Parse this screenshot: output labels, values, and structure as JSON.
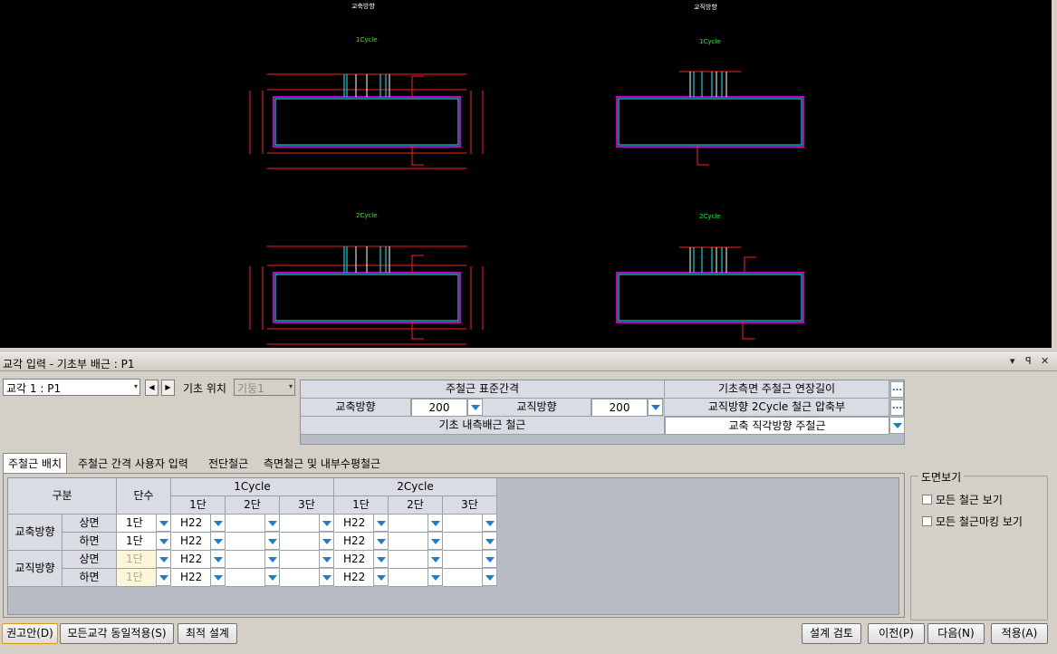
{
  "cad": {
    "view_left_title": "교축방향",
    "view_right_title": "교직방향",
    "cycle1": "1Cycle",
    "cycle2": "2Cycle"
  },
  "panel": {
    "title": "교각 입력 - 기초부 배근 : P1",
    "ctl_dropdown": "▾",
    "ctl_pin": "ꟼ",
    "ctl_close": "✕"
  },
  "top": {
    "pier_select": "교각 1 : P1",
    "prev": "◀",
    "next": "▶",
    "foundation_pos_label": "기초 위치",
    "foundation_pos_value": "기둥1"
  },
  "props": {
    "std_spacing_header": "주철근 표준간격",
    "ext_len_header": "기초측면 주철근 연장길이",
    "axial_label": "교축방향",
    "axial_value": "200",
    "perp_label": "교직방향",
    "perp_value": "200",
    "compress_header": "교직방향 2Cycle 철근 압축부",
    "inner_rebar_label": "기초 내측배근 철근",
    "inner_rebar_value": "교축 직각방향 주철근",
    "ellipsis": "..."
  },
  "tabs": [
    "주철근 배치",
    "주철근 간격 사용자 입력",
    "전단철근",
    "측면철근 및 내부수평철근"
  ],
  "grid": {
    "h_category": "구분",
    "h_tiers": "단수",
    "h_cycle1": "1Cycle",
    "h_cycle2": "2Cycle",
    "h_t1": "1단",
    "h_t2": "2단",
    "h_t3": "3단",
    "groups": [
      {
        "name": "교축방향",
        "rows": [
          {
            "face": "상면",
            "tiers": "1단",
            "c1": [
              "H22",
              "",
              ""
            ],
            "c2": [
              "H22",
              "",
              ""
            ]
          },
          {
            "face": "하면",
            "tiers": "1단",
            "c1": [
              "H22",
              "",
              ""
            ],
            "c2": [
              "H22",
              "",
              ""
            ]
          }
        ]
      },
      {
        "name": "교직방향",
        "rows": [
          {
            "face": "상면",
            "tiers": "1단",
            "c1": [
              "H22",
              "",
              ""
            ],
            "c2": [
              "H22",
              "",
              ""
            ]
          },
          {
            "face": "하면",
            "tiers": "1단",
            "c1": [
              "H22",
              "",
              ""
            ],
            "c2": [
              "H22",
              "",
              ""
            ]
          }
        ]
      }
    ]
  },
  "viewgroup": {
    "title": "도면보기",
    "opt1": "모든 철근 보기",
    "opt2": "모든 철근마킹 보기"
  },
  "buttons": {
    "recommend": "권고안(D)",
    "apply_all": "모든교각 동일적용(S)",
    "optimize": "최적 설계",
    "review": "설계 검토",
    "prev": "이전(P)",
    "next": "다음(N)",
    "apply": "적용(A)"
  },
  "colors": {
    "accent": "#1c7cd5",
    "cad_bg": "#000000",
    "rebar": "#ff0000",
    "concrete": "#ff00ff"
  }
}
